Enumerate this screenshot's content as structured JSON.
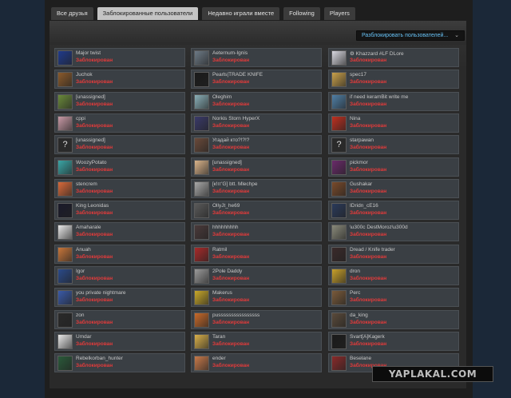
{
  "tabs": [
    {
      "label": "Все друзья",
      "active": false
    },
    {
      "label": "Заблокированные пользователи",
      "active": true
    },
    {
      "label": "Недавно играли вместе",
      "active": false
    },
    {
      "label": "Following",
      "active": false
    },
    {
      "label": "Players",
      "active": false
    }
  ],
  "unblock_button": {
    "label": "Разблокировать пользователей..."
  },
  "status_label": "Заблокирован",
  "colors": {
    "status": "#e23b3b",
    "link": "#67c1f5",
    "card": "#3a3f44"
  },
  "users": [
    {
      "name": "Major twist",
      "avatar": "#1f3a8c"
    },
    {
      "name": "Aeternum-Ignis",
      "avatar": "#6d7a86"
    },
    {
      "name": "⚙ Khazzard #LF DLore",
      "avatar": "#d8d8e0"
    },
    {
      "name": "Juchok",
      "avatar": "#8b5a2b"
    },
    {
      "name": "Pearls|TRADE KNIFE",
      "avatar": "#1a1a1a"
    },
    {
      "name": "spec17",
      "avatar": "#c9a04a"
    },
    {
      "name": "[unassigned]",
      "avatar": "#6a8a3a"
    },
    {
      "name": "Oleghim",
      "avatar": "#8ab0b8"
    },
    {
      "name": "if need keramBit write me",
      "avatar": "#4f7fa6"
    },
    {
      "name": "cppi",
      "avatar": "#c89aa6"
    },
    {
      "name": "Norkis Storn HyperX",
      "avatar": "#3a3a6a"
    },
    {
      "name": "Nina",
      "avatar": "#c03020"
    },
    {
      "name": "[unassigned]",
      "avatar": "q"
    },
    {
      "name": "Угадай кто?!?!?",
      "avatar": "#6a4a3a"
    },
    {
      "name": "starpawan",
      "avatar": "q"
    },
    {
      "name": "WoozyPotato",
      "avatar": "#3aa6a6"
    },
    {
      "name": "[unassigned]",
      "avatar": "#d9b38a"
    },
    {
      "name": "pickmor",
      "avatar": "#6a2a6a"
    },
    {
      "name": "stencrem",
      "avatar": "#d86a3a"
    },
    {
      "name": "[к!гг'G] btt. Mlechpe",
      "avatar": "#a8a8a8"
    },
    {
      "name": "Gushakar",
      "avatar": "#7a4a2a"
    },
    {
      "name": "King Leonidas",
      "avatar": "#1a1a2a"
    },
    {
      "name": "OllyJt_he69",
      "avatar": "#5a5a5a"
    },
    {
      "name": "IDridn_cE16",
      "avatar": "#2a3a5a"
    },
    {
      "name": "Amaharale",
      "avatar": "#e8e8e8"
    },
    {
      "name": "hhhhhhhhh",
      "avatar": "#4a3a3a"
    },
    {
      "name": "\\u300c DestMoroz\\u300d",
      "avatar": "#8a8a7a"
    },
    {
      "name": "Anuah",
      "avatar": "#c8763a"
    },
    {
      "name": "Ratmil",
      "avatar": "#a82a2a"
    },
    {
      "name": "Dread / Knife trader",
      "avatar": "#3a2a2a"
    },
    {
      "name": "Igor",
      "avatar": "#2a4a8a"
    },
    {
      "name": "2Pole Daddy",
      "avatar": "#9a9a9a"
    },
    {
      "name": "dron",
      "avatar": "#c8a02a"
    },
    {
      "name": "you private nightmare",
      "avatar": "#3a5aa8"
    },
    {
      "name": "Makerus",
      "avatar": "#c8a82a"
    },
    {
      "name": "Perc",
      "avatar": "#7a5a3a"
    },
    {
      "name": "zon",
      "avatar": "#2a2a2a"
    },
    {
      "name": "pussssssssssssssss",
      "avatar": "#c86a2a"
    },
    {
      "name": "da_king",
      "avatar": "#5a4a3a"
    },
    {
      "name": "Umdar",
      "avatar": "#e8e8e8"
    },
    {
      "name": "Taran",
      "avatar": "#d8b04a"
    },
    {
      "name": "Svart[A]Kagerk",
      "avatar": "#1a1a1a"
    },
    {
      "name": "Rebelkorban_hunter",
      "avatar": "#2a5a3a"
    },
    {
      "name": "ender",
      "avatar": "#c87a4a"
    },
    {
      "name": "Beselane",
      "avatar": "#8a2a2a"
    }
  ],
  "watermark": "YAPLAKAL.COM"
}
